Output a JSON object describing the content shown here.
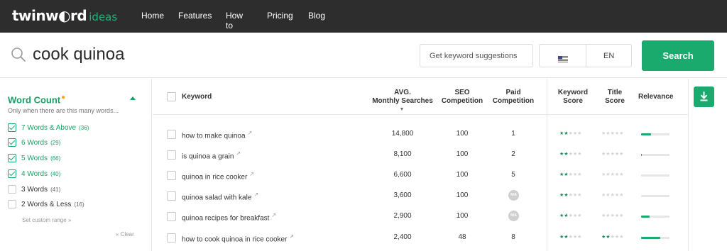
{
  "app": {
    "logo_main": "twinw◐rd",
    "logo_sub": "ideas"
  },
  "nav": {
    "items": [
      "Home",
      "Features",
      "How to",
      "Pricing",
      "Blog"
    ]
  },
  "search": {
    "query": "cook quinoa",
    "suggest_label": "Get keyword suggestions",
    "language": "EN",
    "search_label": "Search"
  },
  "sidebar": {
    "title": "Word Count",
    "subtitle": "Only when there are this many words...",
    "options": [
      {
        "label": "7 Words & Above",
        "count": "(36)",
        "checked": true
      },
      {
        "label": "6 Words",
        "count": "(29)",
        "checked": true
      },
      {
        "label": "5 Words",
        "count": "(66)",
        "checked": true
      },
      {
        "label": "4 Words",
        "count": "(40)",
        "checked": true
      },
      {
        "label": "3 Words",
        "count": "(41)",
        "checked": false
      },
      {
        "label": "2 Words & Less",
        "count": "(16)",
        "checked": false
      }
    ],
    "custom_range": "Set custom range »",
    "clear": "« Clear"
  },
  "table": {
    "headers": {
      "keyword": "Keyword",
      "avg_line1": "AVG.",
      "avg_line2": "Monthly Searches",
      "seo_line1": "SEO",
      "seo_line2": "Competition",
      "paid_line1": "Paid",
      "paid_line2": "Competition",
      "kw_score_line1": "Keyword",
      "kw_score_line2": "Score",
      "title_score_line1": "Title",
      "title_score_line2": "Score",
      "relevance": "Relevance"
    },
    "rows": [
      {
        "keyword": "how to make quinoa",
        "searches": "14,800",
        "seo": "100",
        "paid": "1",
        "kw_score": 2,
        "title_score": 0,
        "relevance": 0.35
      },
      {
        "keyword": "is quinoa a grain",
        "searches": "8,100",
        "seo": "100",
        "paid": "2",
        "kw_score": 2,
        "title_score": 0,
        "relevance": 0.03
      },
      {
        "keyword": "quinoa in rice cooker",
        "searches": "6,600",
        "seo": "100",
        "paid": "5",
        "kw_score": 2,
        "title_score": 0,
        "relevance": 0.0
      },
      {
        "keyword": "quinoa salad with kale",
        "searches": "3,600",
        "seo": "100",
        "paid": "N/A",
        "kw_score": 2,
        "title_score": 0,
        "relevance": 0.0
      },
      {
        "keyword": "quinoa recipes for breakfast",
        "searches": "2,900",
        "seo": "100",
        "paid": "N/A",
        "kw_score": 2,
        "title_score": 0,
        "relevance": 0.3
      },
      {
        "keyword": "how to cook quinoa in rice cooker",
        "searches": "2,400",
        "seo": "48",
        "paid": "8",
        "kw_score": 2,
        "title_score": 2,
        "relevance": 0.68
      }
    ]
  },
  "colors": {
    "brand": "#1aaa6d",
    "topbar": "#2d2d2d",
    "star": "#1a8a55"
  },
  "icons": {
    "search": "search-icon",
    "download": "download-icon",
    "external": "external-link-icon",
    "flag": "us-flag-icon"
  }
}
